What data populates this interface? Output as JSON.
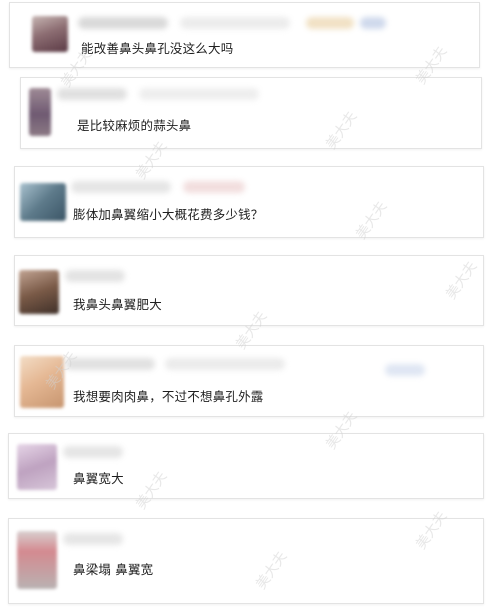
{
  "comments": [
    {
      "text": "能改善鼻头鼻孔没这么大吗"
    },
    {
      "text": "是比较麻烦的蒜头鼻"
    },
    {
      "text": "膨体加鼻翼缩小大概花费多少钱？"
    },
    {
      "text": "我鼻头鼻翼肥大"
    },
    {
      "text": "我想要肉肉鼻，不过不想鼻孔外露"
    },
    {
      "text": "鼻翼宽大"
    },
    {
      "text": "鼻梁塌 鼻翼宽"
    }
  ],
  "watermark": {
    "text": "美大夫"
  }
}
